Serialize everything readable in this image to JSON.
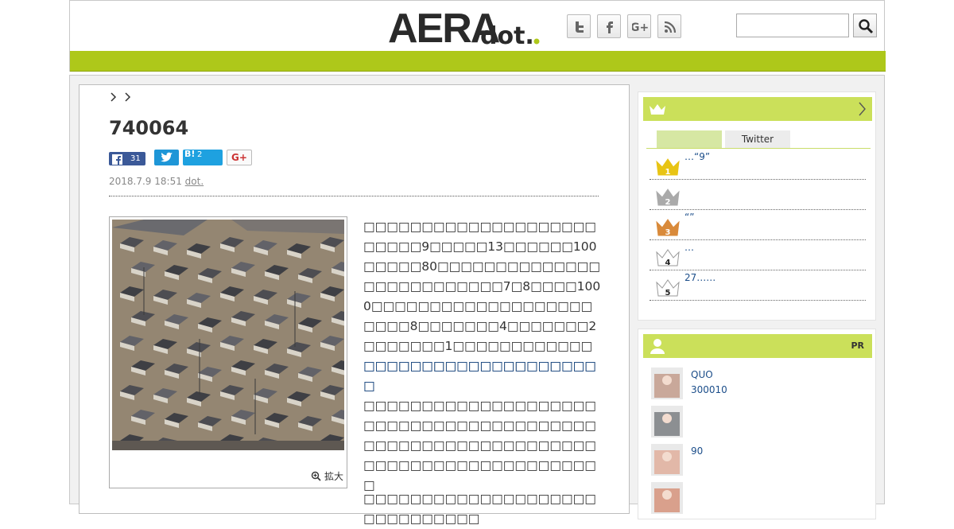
{
  "header": {
    "logo_text_main": "AERA",
    "logo_text_sub": "dot.",
    "social_icons": [
      "twitter-icon",
      "facebook-icon",
      "google-plus-icon",
      "rss-icon"
    ],
    "search": {
      "value": "",
      "placeholder": ""
    },
    "brand_color": "#aec81a"
  },
  "article": {
    "breadcrumb": [
      "",
      ""
    ],
    "title": "740064",
    "share": {
      "facebook_count": "31",
      "twitter_label": "",
      "hatena_label": "B!",
      "hatena_count": "2",
      "google_plus_label": "G+"
    },
    "date": "2018.7.9 18:51",
    "author": "dot.",
    "photo_caption_zoom": "拡大",
    "paragraphs": [
      "□□□□□□□□□□□□□□□□□□□□□□□□□9□□□□□13□□□□□□100□□□□□80□□□□□□□□□□□□□□□□□□□□□□□□□□7□8□□□□1000□□□□□□□□□□□□□□□□□□□□□□□8□□□□□□□4□□□□□□□2□□□□□□□1□□□□□□□□□□□□□□□□□□□□□□□□□□□□□□□□□",
      "□□□□□□□□□□□□□□□□□□□□□",
      "□□□□□□□□□□□□□□□□□□□□□□□□□□□□□□□□□□□□□□□□□□□□□□□□□□□□□□□□□□□□□□□□□□□□□□□□□□□□□□□□□",
      "□□□□□□□□□□□□□□□□□□□□□□□□□□□□□□"
    ]
  },
  "ranking": {
    "header_icon": "crown-icon",
    "tabs": [
      "",
      "Twitter"
    ],
    "items": [
      {
        "rank": "1",
        "text": "…“9”",
        "color": "#e8c414"
      },
      {
        "rank": "2",
        "text": "",
        "color": "#aaaaaa"
      },
      {
        "rank": "3",
        "text": "“”",
        "color": "#d98a3a"
      },
      {
        "rank": "4",
        "text": "…",
        "color": "#ffffff"
      },
      {
        "rank": "5",
        "text": "27……",
        "color": "#ffffff"
      }
    ]
  },
  "pr": {
    "header_icon": "person-icon",
    "label": "PR",
    "items": [
      {
        "line1": "QUO",
        "line2": "300010"
      },
      {
        "line1": "",
        "line2": ""
      },
      {
        "line1": "90",
        "line2": ""
      },
      {
        "line1": "",
        "line2": ""
      }
    ]
  }
}
